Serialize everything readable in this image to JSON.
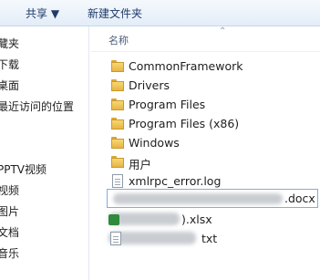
{
  "toolbar": {
    "share_label": "共享 ▼",
    "new_folder_label": "新建文件夹"
  },
  "nav": {
    "items": [
      {
        "label": "藏夹"
      },
      {
        "label": "下载"
      },
      {
        "label": "桌面"
      },
      {
        "label": "最近访问的位置"
      },
      {
        "label": "PPTV视频"
      },
      {
        "label": "视频"
      },
      {
        "label": "图片"
      },
      {
        "label": "文档"
      },
      {
        "label": "音乐"
      }
    ]
  },
  "columns": {
    "name_header": "名称"
  },
  "files": [
    {
      "name": "CommonFramework",
      "icon": "folder-icon"
    },
    {
      "name": "Drivers",
      "icon": "folder-icon"
    },
    {
      "name": "Program Files",
      "icon": "folder-icon"
    },
    {
      "name": "Program Files (x86)",
      "icon": "folder-icon"
    },
    {
      "name": "Windows",
      "icon": "folder-icon"
    },
    {
      "name": "用户",
      "icon": "folder-icon"
    },
    {
      "name": "xmlrpc_error.log",
      "icon": "file-icon"
    },
    {
      "name": ".docx",
      "icon": "word-doc-icon"
    },
    {
      "name": ").xlsx",
      "icon": "excel-icon"
    },
    {
      "name": "txt",
      "icon": "text-file-icon"
    }
  ]
}
